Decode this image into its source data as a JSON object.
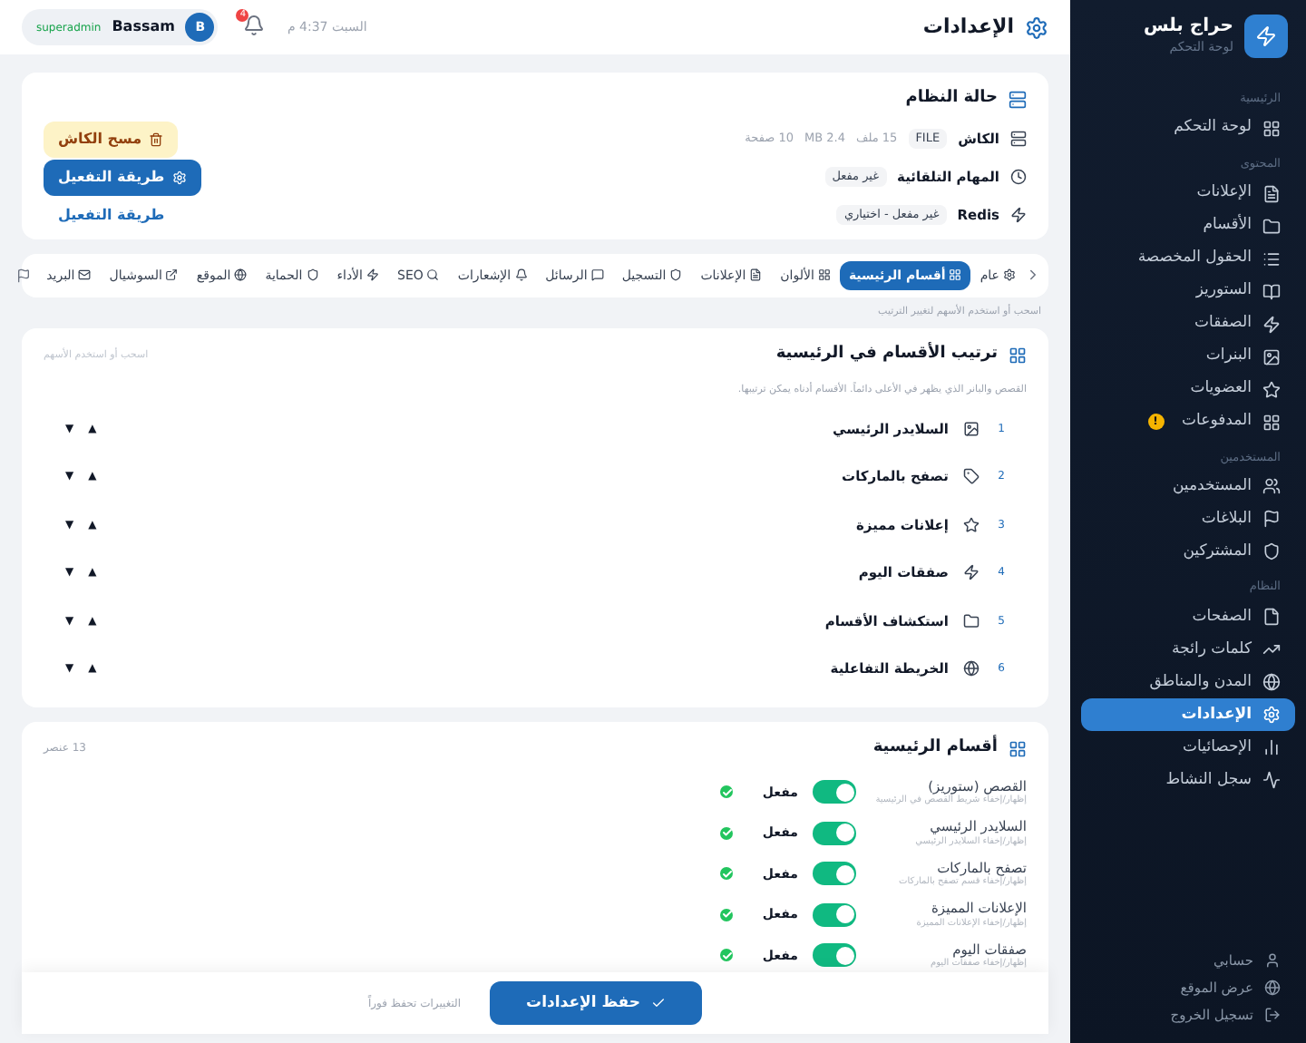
{
  "sidebar": {
    "brand": {
      "title": "حراج بلس",
      "subtitle": "لوحة التحكم"
    },
    "sections": [
      {
        "label": "الرئيسية",
        "items": [
          {
            "label": "لوحة التحكم",
            "selected": false
          }
        ]
      },
      {
        "label": "المحتوى",
        "items": [
          {
            "label": "الإعلانات",
            "selected": false
          },
          {
            "label": "الأقسام",
            "selected": false
          },
          {
            "label": "الحقول المخصصة",
            "selected": false
          },
          {
            "label": "الستوريز",
            "selected": false
          },
          {
            "label": "الصفقات",
            "selected": false
          },
          {
            "label": "البنرات",
            "selected": false
          },
          {
            "label": "العضويات",
            "selected": false
          },
          {
            "label": "المدفوعات",
            "selected": false,
            "badge": "!"
          }
        ]
      },
      {
        "label": "المستخدمين",
        "items": [
          {
            "label": "المستخدمين",
            "selected": false
          },
          {
            "label": "البلاغات",
            "selected": false
          },
          {
            "label": "المشتركين",
            "selected": false
          }
        ]
      },
      {
        "label": "النظام",
        "items": [
          {
            "label": "الصفحات",
            "selected": false
          },
          {
            "label": "كلمات رائجة",
            "selected": false
          },
          {
            "label": "المدن والمناطق",
            "selected": false
          },
          {
            "label": "الإعدادات",
            "selected": true
          },
          {
            "label": "الإحصائيات",
            "selected": false
          },
          {
            "label": "سجل النشاط",
            "selected": false
          }
        ]
      }
    ],
    "footer_items": [
      {
        "label": "حسابي"
      },
      {
        "label": "عرض الموقع"
      },
      {
        "label": "تسجيل الخروج"
      }
    ]
  },
  "header": {
    "title": "الإعدادات",
    "date": "السبت 4:37 م",
    "notifications": "4",
    "user": {
      "initial": "B",
      "name": "Bassam",
      "role": "superadmin"
    }
  },
  "system_status": {
    "title": "حالة النظام",
    "rows": [
      {
        "label": "الكاش",
        "badges": [
          "FILE"
        ],
        "details": [
          "15 ملف",
          "MB 2.4",
          "10 صفحة"
        ],
        "action": {
          "kind": "warning",
          "label": "مسح الكاش"
        }
      },
      {
        "label": "المهام التلقائية",
        "badges": [
          "غير مفعل"
        ],
        "details": [],
        "action": {
          "kind": "primary",
          "label": "طريقة التفعيل"
        }
      },
      {
        "label": "Redis",
        "badges": [
          "غير مفعل - اختياري"
        ],
        "details": [],
        "action": {
          "kind": "link",
          "label": "طريقة التفعيل"
        }
      }
    ]
  },
  "tabs": [
    {
      "label": "عام",
      "selected": false
    },
    {
      "label": "أقسام الرئيسية",
      "selected": true
    },
    {
      "label": "الألوان",
      "selected": false
    },
    {
      "label": "الإعلانات",
      "selected": false
    },
    {
      "label": "التسجيل",
      "selected": false
    },
    {
      "label": "الرسائل",
      "selected": false
    },
    {
      "label": "الإشعارات",
      "selected": false
    },
    {
      "label": "SEO",
      "selected": false
    },
    {
      "label": "الأداء",
      "selected": false
    },
    {
      "label": "الحماية",
      "selected": false
    },
    {
      "label": "الموقع",
      "selected": false
    },
    {
      "label": "السوشيال",
      "selected": false
    },
    {
      "label": "البريد",
      "selected": false
    }
  ],
  "tabs_hint": "اسحب أو استخدم الأسهم لتغيير الترتيب",
  "order_card": {
    "title": "ترتيب الأقسام في الرئيسية",
    "hint": "اسحب أو استخدم الأسهم",
    "description": "القصص والبانر الذي يظهر في الأعلى دائماً. الأقسام أدناه يمكن ترتيبها.",
    "items": [
      {
        "number": "1",
        "label": "السلايدر الرئيسي",
        "move_up": "▲",
        "move_down": "▼"
      },
      {
        "number": "2",
        "label": "تصفح بالماركات",
        "move_up": "▲",
        "move_down": "▼"
      },
      {
        "number": "3",
        "label": "إعلانات مميزة",
        "move_up": "▲",
        "move_down": "▼"
      },
      {
        "number": "4",
        "label": "صفقات اليوم",
        "move_up": "▲",
        "move_down": "▼"
      },
      {
        "number": "5",
        "label": "استكشاف الأقسام",
        "move_up": "▲",
        "move_down": "▼"
      },
      {
        "number": "6",
        "label": "الخريطة التفاعلية",
        "move_up": "▲",
        "move_down": "▼"
      }
    ]
  },
  "sections_card": {
    "title": "أقسام الرئيسية",
    "count": "13 عنصر",
    "rows": [
      {
        "name": "القصص (ستوريز)",
        "description": "إظهار/إخفاء شريط القصص في الرئيسية",
        "on": true,
        "state_label": "مفعل",
        "checked": true
      },
      {
        "name": "السلايدر الرئيسي",
        "description": "إظهار/إخفاء السلايدر الرئيسي",
        "on": true,
        "state_label": "مفعل",
        "checked": true
      },
      {
        "name": "تصفح بالماركات",
        "description": "إظهار/إخفاء قسم تصفح بالماركات",
        "on": true,
        "state_label": "مفعل",
        "checked": true
      },
      {
        "name": "الإعلانات المميزة",
        "description": "إظهار/إخفاء الإعلانات المميزة",
        "on": true,
        "state_label": "مفعل",
        "checked": true
      },
      {
        "name": "صفقات اليوم",
        "description": "إظهار/إخفاء صفقات اليوم",
        "on": true,
        "state_label": "مفعل",
        "checked": true
      }
    ]
  },
  "save_bar": {
    "button": "حفظ الإعدادات",
    "note": "التغييرات تحفظ فوراً"
  }
}
